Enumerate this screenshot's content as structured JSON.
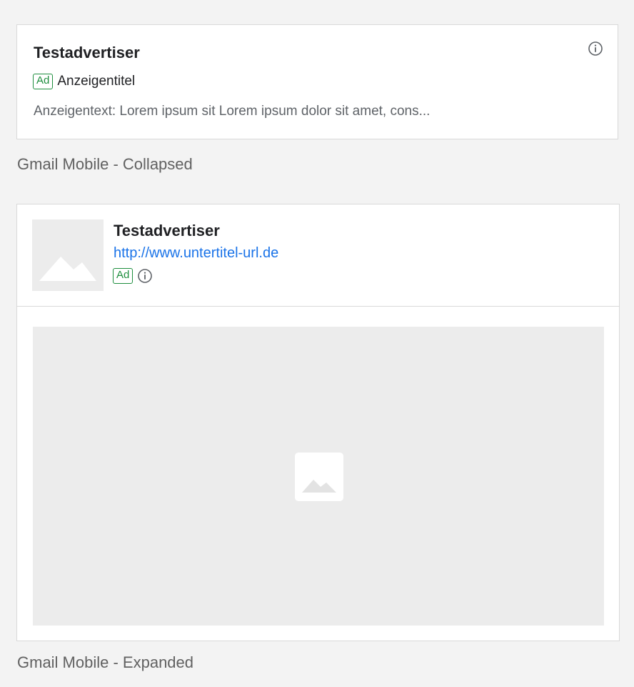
{
  "collapsed": {
    "advertiser": "Testadvertiser",
    "ad_badge": "Ad",
    "headline": "Anzeigentitel",
    "body": "Anzeigentext: Lorem ipsum sit Lorem ipsum dolor sit amet, cons...",
    "caption": "Gmail Mobile - Collapsed",
    "info_icon": "info-icon"
  },
  "expanded": {
    "advertiser": "Testadvertiser",
    "url": "http://www.untertitel-url.de",
    "ad_badge": "Ad",
    "caption": "Gmail Mobile - Expanded",
    "logo_placeholder_icon": "image-placeholder-icon",
    "image_placeholder_icon": "image-placeholder-icon"
  },
  "colors": {
    "background": "#f3f3f3",
    "card": "#ffffff",
    "border": "#d9d9d9",
    "ad_badge": "#1e8e3e",
    "link": "#1a73e8",
    "placeholder": "#ececec"
  }
}
